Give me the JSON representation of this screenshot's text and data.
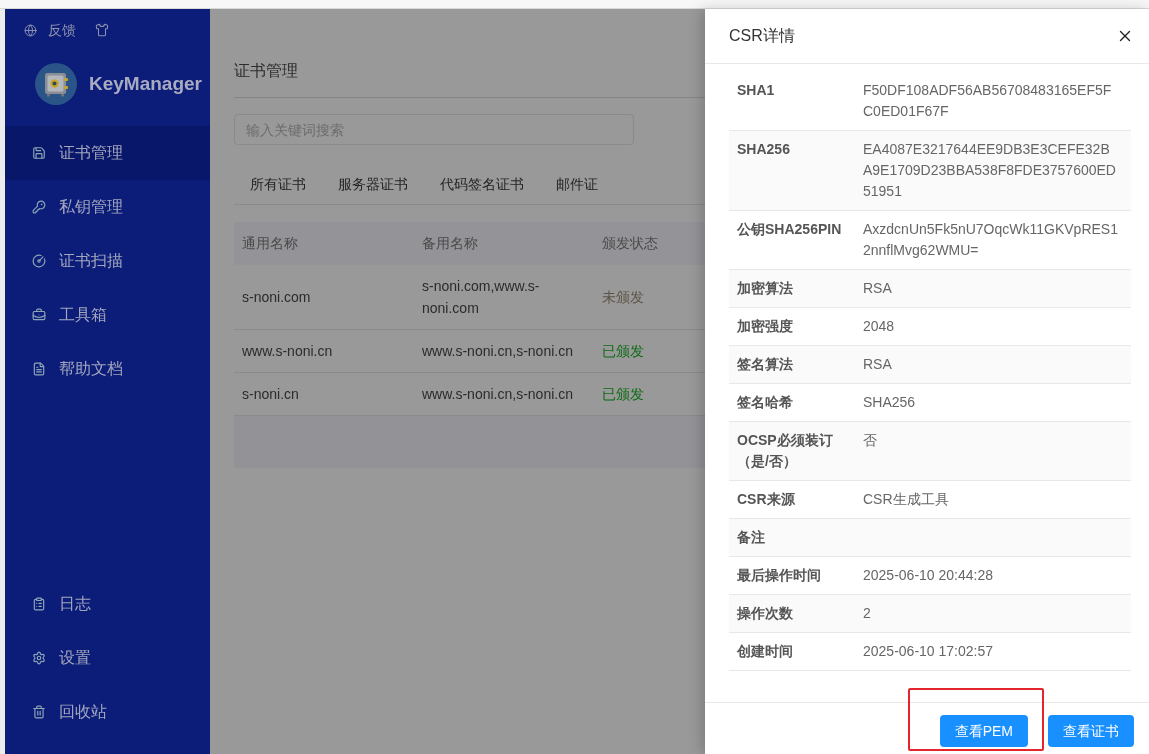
{
  "sidebar": {
    "toolbar": {
      "feedback_label": "反馈"
    },
    "brand": {
      "name": "KeyManager"
    },
    "menu_items": [
      {
        "label": "证书管理",
        "selected": true
      },
      {
        "label": "私钥管理",
        "selected": false
      },
      {
        "label": "证书扫描",
        "selected": false
      },
      {
        "label": "工具箱",
        "selected": false
      },
      {
        "label": "帮助文档",
        "selected": false
      }
    ],
    "bottom_items": [
      {
        "label": "日志",
        "selected": false
      },
      {
        "label": "设置",
        "selected": false
      },
      {
        "label": "回收站",
        "selected": false
      }
    ]
  },
  "main": {
    "page_title": "证书管理",
    "search": {
      "placeholder": "输入关键词搜索"
    },
    "tabs": [
      {
        "label": "所有证书"
      },
      {
        "label": "服务器证书"
      },
      {
        "label": "代码签名证书"
      },
      {
        "label": "邮件证"
      }
    ],
    "table": {
      "columns": [
        "通用名称",
        "备用名称",
        "颁发状态"
      ],
      "rows": [
        {
          "common_name": "s-noni.com",
          "alt_names": "s-noni.com,www.s-noni.com",
          "status": "未颁发",
          "issued": false
        },
        {
          "common_name": "www.s-noni.cn",
          "alt_names": "www.s-noni.cn,s-noni.cn",
          "status": "已颁发",
          "issued": true
        },
        {
          "common_name": "s-noni.cn",
          "alt_names": "www.s-noni.cn,s-noni.cn",
          "status": "已颁发",
          "issued": true
        }
      ]
    }
  },
  "drawer": {
    "title": "CSR详情",
    "fields": [
      {
        "label": "SHA1",
        "value": "F50DF108ADF56AB56708483165EF5FC0ED01F67F"
      },
      {
        "label": "SHA256",
        "value": "EA4087E3217644EE9DB3E3CEFE32BA9E1709D23BBA538F8FDE3757600ED51951"
      },
      {
        "label": "公钥SHA256PIN",
        "value": "AxzdcnUn5Fk5nU7OqcWk11GKVpRES12nnflMvg62WMU="
      },
      {
        "label": "加密算法",
        "value": "RSA"
      },
      {
        "label": "加密强度",
        "value": "2048"
      },
      {
        "label": "签名算法",
        "value": "RSA"
      },
      {
        "label": "签名哈希",
        "value": "SHA256"
      },
      {
        "label": "OCSP必须装订（是/否）",
        "value": "否"
      },
      {
        "label": "CSR来源",
        "value": "CSR生成工具"
      },
      {
        "label": "备注"
      },
      {
        "label": "最后操作时间",
        "value": "2025-06-10 20:44:28"
      },
      {
        "label": "操作次数",
        "value": "2"
      },
      {
        "label": "创建时间",
        "value": "2025-06-10 17:02:57"
      }
    ],
    "buttons": [
      {
        "label": "查看PEM",
        "highlighted": true
      },
      {
        "label": "查看证书",
        "highlighted": false
      }
    ]
  }
}
